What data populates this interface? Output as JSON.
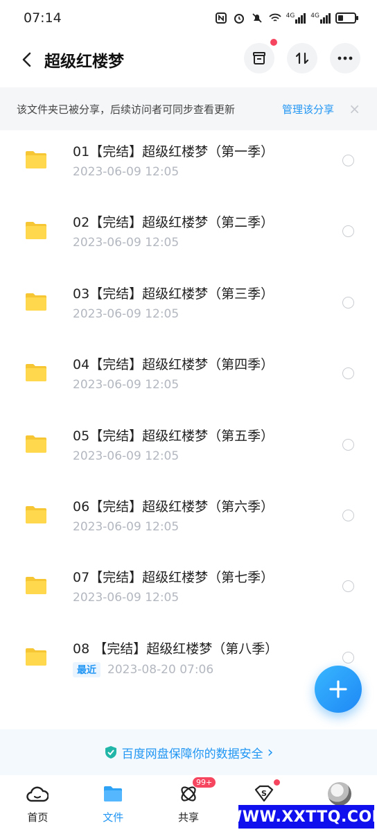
{
  "status_bar": {
    "time": "07:14",
    "signal_1": "4G",
    "signal_2": "4G"
  },
  "header": {
    "title": "超级红楼梦",
    "back_icon": "chevron-left-icon",
    "actions": [
      "archive-icon",
      "sort-icon",
      "more-icon"
    ]
  },
  "banner": {
    "text": "该文件夹已被分享，后续访问者可同步查看更新",
    "link": "管理该分享",
    "close": "×"
  },
  "files": [
    {
      "name": "01【完结】超级红楼梦（第一季）",
      "date": "2023-06-09  12:05",
      "badge": ""
    },
    {
      "name": "02【完结】超级红楼梦（第二季）",
      "date": "2023-06-09  12:05",
      "badge": ""
    },
    {
      "name": "03【完结】超级红楼梦（第三季）",
      "date": "2023-06-09  12:05",
      "badge": ""
    },
    {
      "name": "04【完结】超级红楼梦（第四季）",
      "date": "2023-06-09  12:05",
      "badge": ""
    },
    {
      "name": "05【完结】超级红楼梦（第五季）",
      "date": "2023-06-09  12:05",
      "badge": ""
    },
    {
      "name": "06【完结】超级红楼梦（第六季）",
      "date": "2023-06-09  12:05",
      "badge": ""
    },
    {
      "name": "07【完结】超级红楼梦（第七季）",
      "date": "2023-06-09  12:05",
      "badge": ""
    },
    {
      "name": "08 【完结】超级红楼梦（第八季）",
      "date": "2023-08-20  07:06",
      "badge": "最近"
    }
  ],
  "security_notice": {
    "text": "百度网盘保障你的数据安全",
    "arrow": "›"
  },
  "bottom_nav": [
    {
      "label": "首页",
      "icon": "cloud-home-icon",
      "active": false
    },
    {
      "label": "文件",
      "icon": "folder-icon",
      "active": true
    },
    {
      "label": "共享",
      "icon": "atom-share-icon",
      "active": false,
      "badge": "99+"
    },
    {
      "label": "",
      "icon": "vip-s-icon",
      "active": false,
      "dot": true
    },
    {
      "label": "",
      "icon": "avatar",
      "active": false
    }
  ],
  "watermark": "WWW.XXTTQ.COM",
  "colors": {
    "accent": "#2196f3",
    "folder": "#ffd54f",
    "badge_red": "#f5455f"
  }
}
